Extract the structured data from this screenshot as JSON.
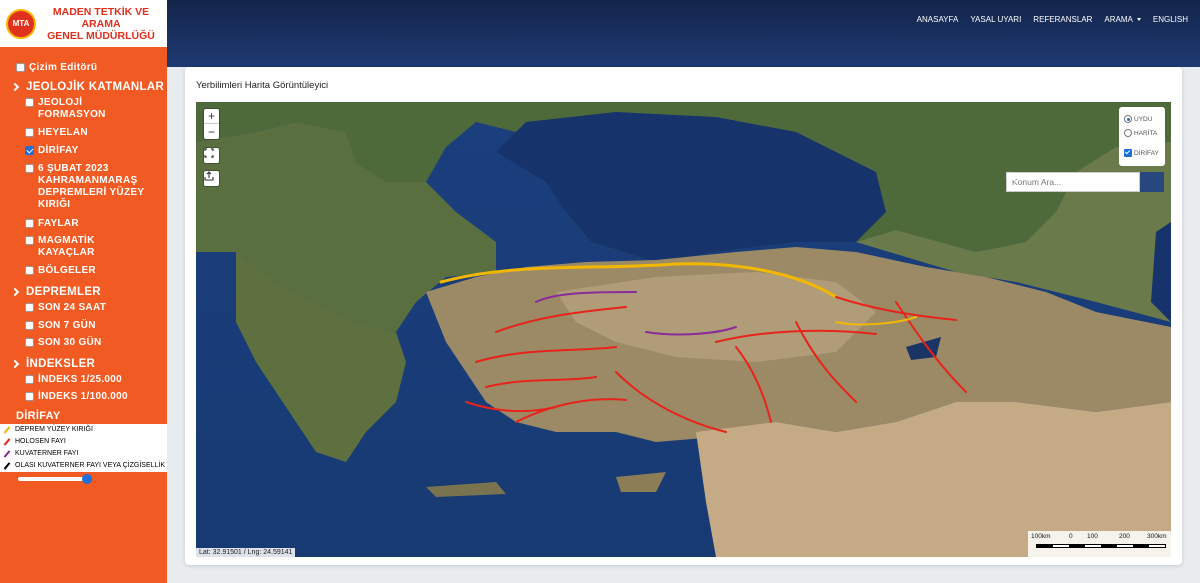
{
  "logo": {
    "badge": "MTA",
    "line1": "MADEN TETKİK VE ARAMA",
    "line2": "GENEL MÜDÜRLÜĞÜ"
  },
  "sidebar": {
    "drawing_editor": "Çizim Editörü",
    "sections": {
      "geology": "JEOLOJİK KATMANLAR",
      "earthquakes": "DEPREMLER",
      "indexes": "İNDEKSLER"
    },
    "geology_items": [
      {
        "label": "JEOLOJİ FORMASYON",
        "checked": false
      },
      {
        "label": "HEYELAN",
        "checked": false
      },
      {
        "label": "DİRİFAY",
        "checked": true
      },
      {
        "label": "6 ŞUBAT 2023 KAHRAMANMARAŞ DEPREMLERİ YÜZEY KIRIĞI",
        "checked": false
      },
      {
        "label": "FAYLAR",
        "checked": false
      },
      {
        "label": "MAGMATİK KAYAÇLAR",
        "checked": false
      },
      {
        "label": "BÖLGELER",
        "checked": false
      }
    ],
    "earthquake_items": [
      {
        "label": "SON 24 SAAT",
        "checked": false
      },
      {
        "label": "SON 7 GÜN",
        "checked": false
      },
      {
        "label": "SON 30 GÜN",
        "checked": false
      }
    ],
    "index_items": [
      {
        "label": "İNDEKS 1/25.000",
        "checked": false
      },
      {
        "label": "İNDEKS 1/100.000",
        "checked": false
      }
    ],
    "legend_title": "DİRİFAY",
    "legend": [
      {
        "label": "DEPREM YÜZEY KIRIĞI",
        "color": "#f2b700"
      },
      {
        "label": "HOLOSEN FAYI",
        "color": "#e8231a"
      },
      {
        "label": "KUVATERNER FAYI",
        "color": "#8a2a9b"
      },
      {
        "label": "OLASI KUVATERNER FAYI VEYA ÇİZGİSELLİK",
        "color": "#000000"
      }
    ],
    "opacity_value": 1.0
  },
  "nav": {
    "items": [
      "ANASAYFA",
      "YASAL UYARI",
      "REFERANSLAR",
      "ARAMA",
      "ENGLISH"
    ]
  },
  "card": {
    "title": "Yerbilimleri Harita Görüntüleyici"
  },
  "map": {
    "zoom_in": "+",
    "zoom_out": "−",
    "layers": {
      "option1": "UYDU",
      "option2": "HARİTA",
      "overlay": "DİRİFAY",
      "selected": "UYDU"
    },
    "search_placeholder": "Konum Ara...",
    "coordinates": "Lat: 32.91501 / Lng: 24.59141",
    "scale_labels": [
      "100km",
      "0",
      "100",
      "200",
      "300km"
    ]
  }
}
